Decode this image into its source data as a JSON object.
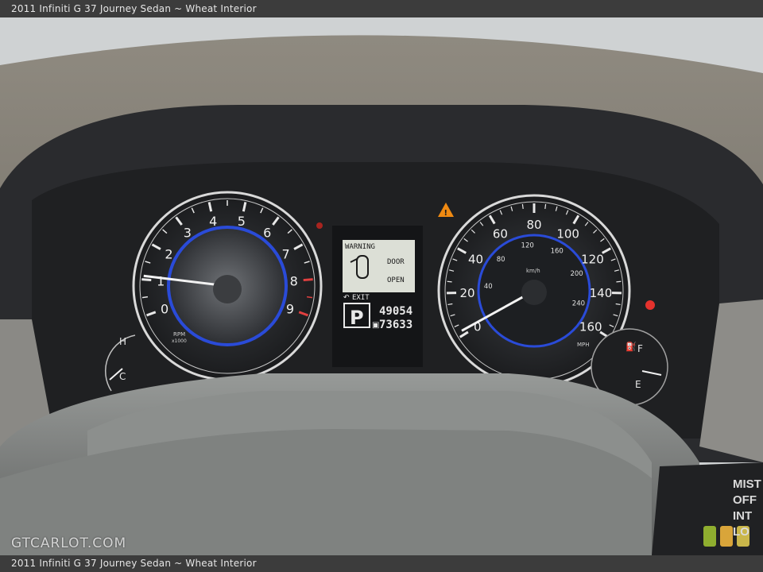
{
  "caption_top": "2011 Infiniti G 37 Journey Sedan ~ Wheat Interior",
  "caption_bottom": "2011 Infiniti G 37 Journey Sedan ~ Wheat Interior",
  "watermark": "GTCARLOT.COM",
  "tachometer": {
    "ticks": [
      "0",
      "1",
      "2",
      "3",
      "4",
      "5",
      "6",
      "7",
      "8",
      "9"
    ],
    "unit_top": "RPM",
    "unit_bottom": "x1000",
    "needle_value": 1.1
  },
  "temp_gauge": {
    "hot": "H",
    "cold": "C"
  },
  "display": {
    "warning": "WARNING",
    "door": "DOOR",
    "open": "OPEN",
    "exit": "EXIT",
    "gear": "P",
    "trip": "49054",
    "odometer": "73633"
  },
  "speedometer": {
    "mph_ticks": [
      "0",
      "20",
      "40",
      "60",
      "80",
      "100",
      "120",
      "140",
      "160"
    ],
    "kmh_ticks": [
      "40",
      "80",
      "120",
      "160",
      "200",
      "240"
    ],
    "kmh_unit": "km/h",
    "mph_unit": "MPH",
    "needle_value": 2
  },
  "fuel_gauge": {
    "full": "F",
    "empty": "E"
  },
  "wiper_stalk": [
    "MIST",
    "OFF",
    "INT",
    "LO"
  ],
  "colors": {
    "warning_amber": "#f08a12",
    "airbag_red": "#e5322d",
    "gauge_blue": "#2a4bd8"
  }
}
